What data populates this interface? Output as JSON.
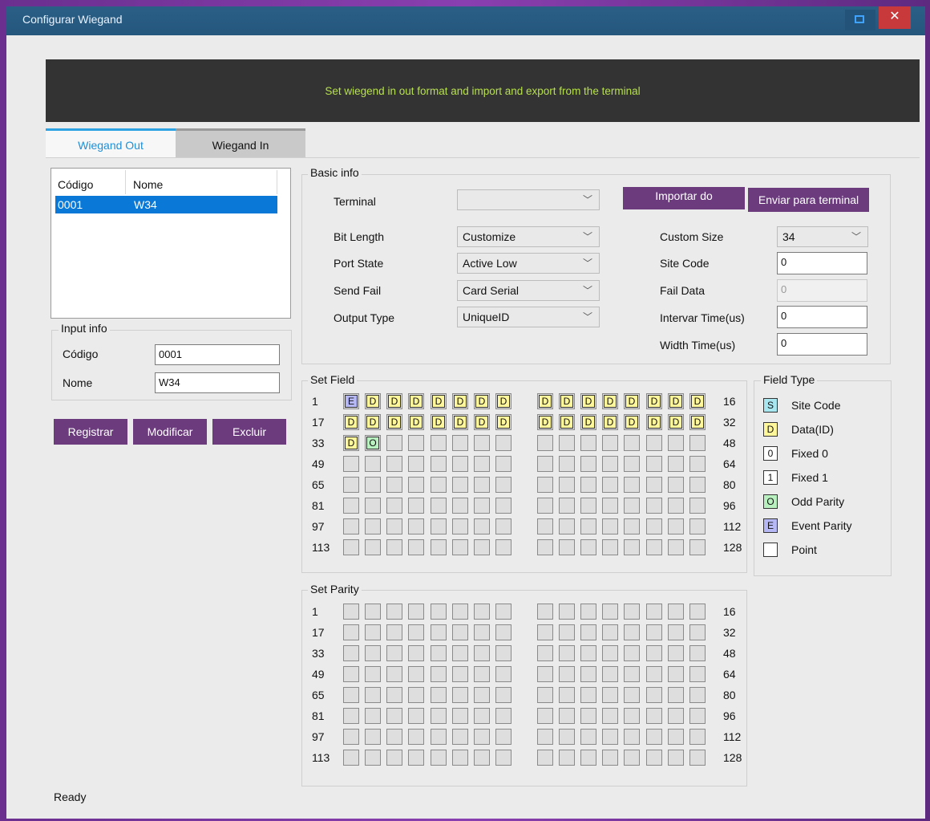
{
  "window": {
    "title": "Configurar Wiegand",
    "close_glyph": "✕"
  },
  "header": {
    "text": "Set wiegend in  out format and import and export from the terminal"
  },
  "tabs": [
    {
      "label": "Wiegand Out",
      "active": true
    },
    {
      "label": "Wiegand In",
      "active": false
    }
  ],
  "list": {
    "headers": [
      "Código",
      "Nome"
    ],
    "rows": [
      {
        "code": "0001",
        "name": "W34",
        "selected": true
      }
    ]
  },
  "input_info": {
    "title": "Input info",
    "codigo_label": "Código",
    "codigo_value": "0001",
    "nome_label": "Nome",
    "nome_value": "W34"
  },
  "actions": {
    "register": "Registrar",
    "modify": "Modificar",
    "delete": "Excluir"
  },
  "basic_info": {
    "title": "Basic info",
    "terminal_label": "Terminal",
    "terminal_value": "",
    "import_button": "Importar do",
    "send_button": "Enviar para terminal",
    "bit_length_label": "Bit Length",
    "bit_length_value": "Customize",
    "port_state_label": "Port State",
    "port_state_value": "Active Low",
    "send_fail_label": "Send Fail",
    "send_fail_value": "Card Serial",
    "output_type_label": "Output Type",
    "output_type_value": "UniqueID",
    "custom_size_label": "Custom Size",
    "custom_size_value": "34",
    "site_code_label": "Site Code",
    "site_code_value": "0",
    "fail_data_label": "Fail Data",
    "fail_data_value": "0",
    "interval_label": "Intervar Time(us)",
    "interval_value": "0",
    "width_label": "Width Time(us)",
    "width_value": "0"
  },
  "set_field": {
    "title": "Set Field",
    "left_labels": [
      "1",
      "17",
      "33",
      "49",
      "65",
      "81",
      "97",
      "113"
    ],
    "right_labels": [
      "16",
      "32",
      "48",
      "64",
      "80",
      "96",
      "112",
      "128"
    ],
    "bits": [
      "E",
      "D",
      "D",
      "D",
      "D",
      "D",
      "D",
      "D",
      "D",
      "D",
      "D",
      "D",
      "D",
      "D",
      "D",
      "D",
      "D",
      "D",
      "D",
      "D",
      "D",
      "D",
      "D",
      "D",
      "D",
      "D",
      "D",
      "D",
      "D",
      "D",
      "D",
      "D",
      "D",
      "O"
    ]
  },
  "set_parity": {
    "title": "Set Parity",
    "left_labels": [
      "1",
      "17",
      "33",
      "49",
      "65",
      "81",
      "97",
      "113"
    ],
    "right_labels": [
      "16",
      "32",
      "48",
      "64",
      "80",
      "96",
      "112",
      "128"
    ]
  },
  "field_type": {
    "title": "Field Type",
    "items": [
      {
        "code": "S",
        "label": "Site Code",
        "color": "#a8e6f0"
      },
      {
        "code": "D",
        "label": "Data(ID)",
        "color": "#fff79a"
      },
      {
        "code": "0",
        "label": "Fixed 0",
        "color": "#ffffff"
      },
      {
        "code": "1",
        "label": "Fixed 1",
        "color": "#ffffff"
      },
      {
        "code": "O",
        "label": "Odd Parity",
        "color": "#b8f0c0"
      },
      {
        "code": "E",
        "label": "Event Parity",
        "color": "#b6b8f6"
      },
      {
        "code": "",
        "label": "Point",
        "color": "#ffffff"
      }
    ]
  },
  "status": {
    "text": "Ready"
  },
  "colors": {
    "accent_tab": "#2ea3e3",
    "button": "#6b3b7d",
    "header_text": "#b6e04a",
    "selection": "#0a78d7"
  }
}
